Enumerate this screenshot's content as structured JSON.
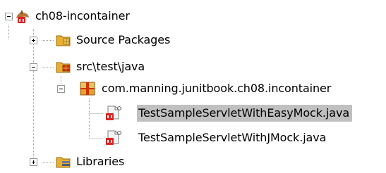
{
  "tree": {
    "selection_color": "#c0c0c0",
    "nodes": [
      {
        "label": "ch08-incontainer",
        "icon": "project-icon",
        "expanded": true
      },
      {
        "label": "Source Packages",
        "icon": "source-folder-icon",
        "expanded": false
      },
      {
        "label": "src\\test\\java",
        "icon": "test-folder-icon",
        "expanded": true
      },
      {
        "label": "com.manning.junitbook.ch08.incontainer",
        "icon": "package-icon",
        "expanded": true
      },
      {
        "label": "TestSampleServletWithEasyMock.java",
        "icon": "java-test-file-icon",
        "selected": true
      },
      {
        "label": "TestSampleServletWithJMock.java",
        "icon": "java-test-file-icon"
      },
      {
        "label": "Libraries",
        "icon": "libraries-folder-icon",
        "expanded": false
      }
    ]
  }
}
